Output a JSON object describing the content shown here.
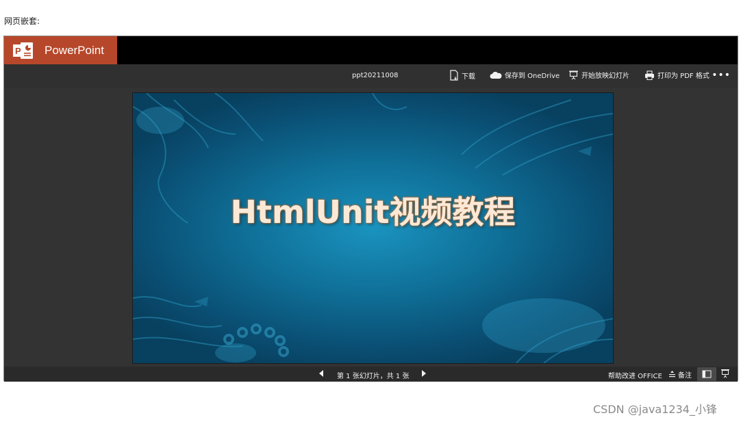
{
  "page": {
    "caption": "网页嵌套:",
    "watermark": "CSDN @java1234_小锋"
  },
  "app": {
    "name": "PowerPoint",
    "logo_letter": "P",
    "brand_color": "#b7472a"
  },
  "toolbar": {
    "filename": "ppt20211008",
    "download_label": "下载",
    "save_label": "保存到 OneDrive",
    "slideshow_label": "开始放映幻灯片",
    "print_label": "打印为 PDF 格式",
    "more_label": "•••"
  },
  "slide": {
    "title": "HtmlUnit视频教程",
    "bg_color": "#0f6f97"
  },
  "statusbar": {
    "slide_count": "第 1 张幻灯片，共 1 张",
    "help_label": "帮助改进 OFFICE",
    "notes_label": "备注"
  },
  "icons": {
    "download": "document-download-icon",
    "cloud": "cloud-icon",
    "present": "projector-icon",
    "print": "printer-icon",
    "prev": "triangle-left-icon",
    "next": "triangle-right-icon",
    "notes": "notes-icon",
    "normal_view": "normal-view-icon",
    "reading_view": "reading-view-icon"
  }
}
